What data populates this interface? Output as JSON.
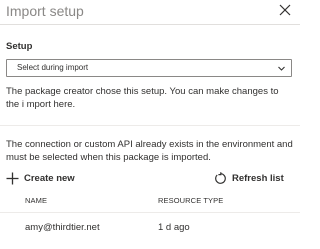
{
  "header": {
    "title": "Import setup",
    "close_icon": "close-icon"
  },
  "setup": {
    "label": "Setup",
    "select": {
      "value": "Select during import",
      "icon": "chevron-down-icon"
    }
  },
  "info_text": "The package creator chose this setup. You can make changes to the i mport here.",
  "description": "The connection or custom API already exists in the environment and must be selected when this package is imported.",
  "commands": {
    "create": {
      "label": "Create new",
      "icon": "plus-icon"
    },
    "refresh": {
      "label": "Refresh list",
      "icon": "refresh-icon"
    }
  },
  "table": {
    "columns": [
      "NAME",
      "RESOURCE TYPE"
    ],
    "rows": [
      {
        "name": "amy@thirdtier.net",
        "type": "1 d ago"
      }
    ]
  },
  "colors": {
    "text": "#323130",
    "muted": "#8a8886",
    "border": "#8a8886",
    "divider": "#edebe9"
  }
}
